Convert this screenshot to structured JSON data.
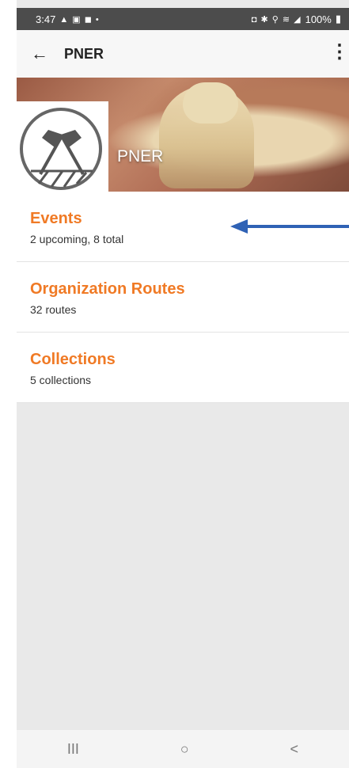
{
  "status_bar": {
    "time": "3:47",
    "battery": "100%"
  },
  "app_bar": {
    "title": "PNER",
    "back_icon": "arrow-left-icon",
    "menu_icon": "more-vert-icon"
  },
  "banner": {
    "title": "PNER",
    "logo_icon": "crossed-flags-logo"
  },
  "menu_items": [
    {
      "title": "Events",
      "subtitle": "2 upcoming, 8 total"
    },
    {
      "title": "Organization Routes",
      "subtitle": "32 routes"
    },
    {
      "title": "Collections",
      "subtitle": "5 collections"
    }
  ],
  "annotation": {
    "arrow_color": "#2f62b5"
  },
  "nav_bar": {
    "recent_label": "III",
    "home_label": "○",
    "back_label": "<"
  },
  "colors": {
    "accent": "#f07a25",
    "status_bar": "#4c4c4c"
  }
}
